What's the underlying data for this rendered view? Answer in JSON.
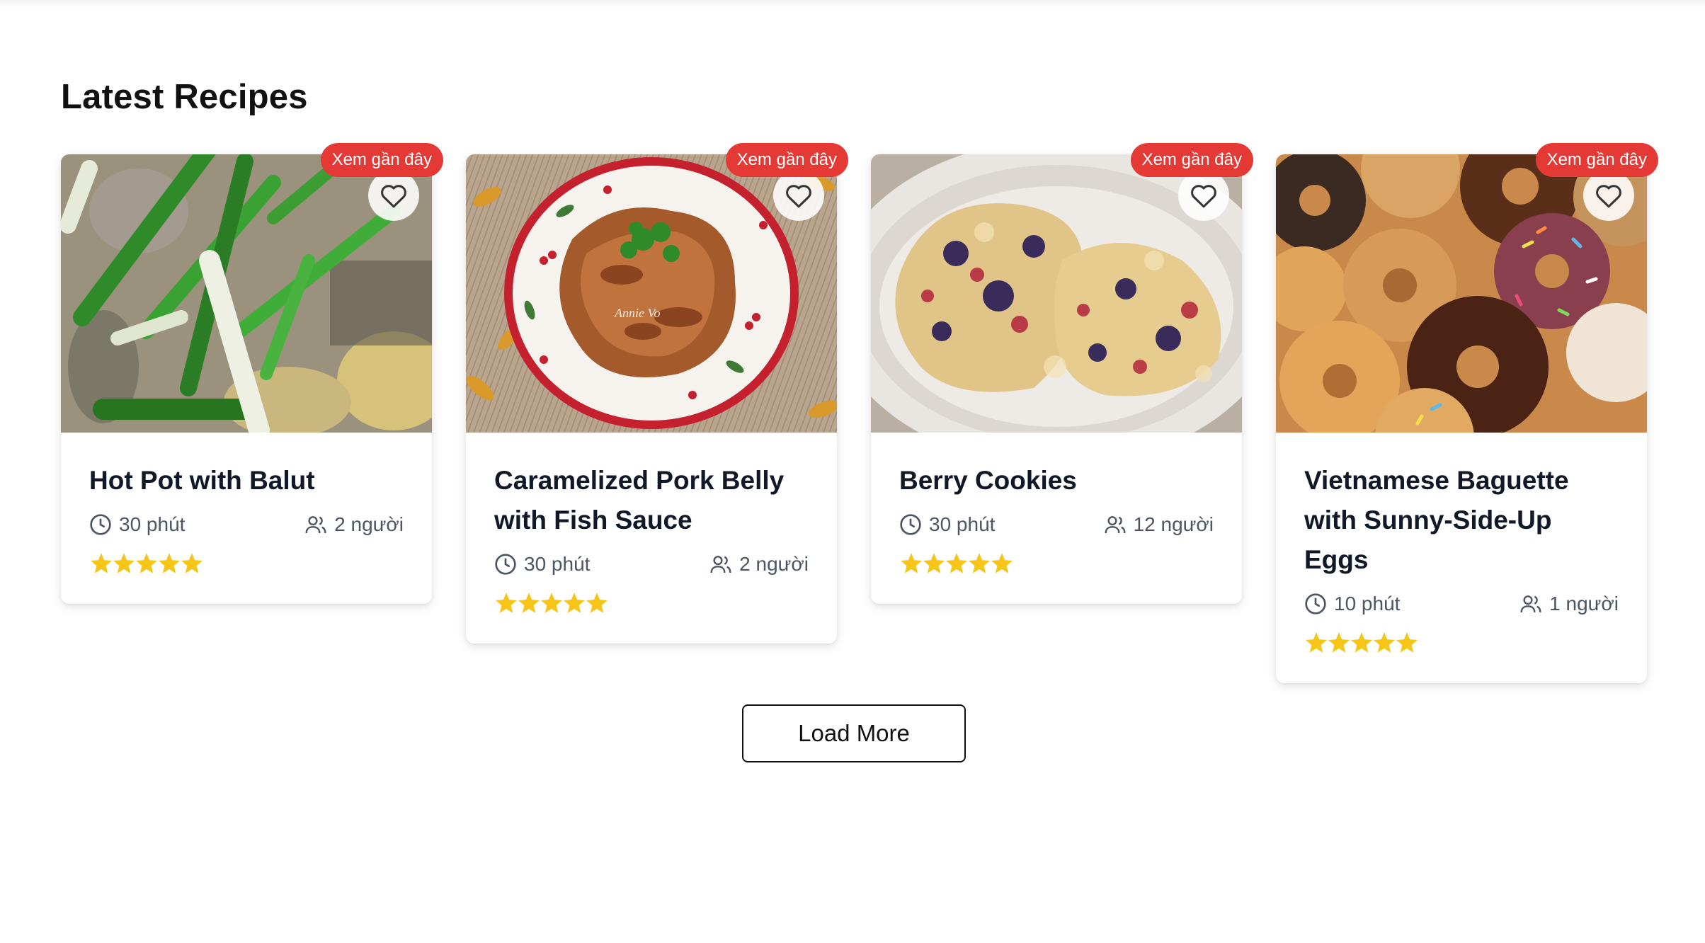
{
  "section": {
    "title": "Latest Recipes"
  },
  "badge_label": "Xem gần đây",
  "rating_max": 5,
  "colors": {
    "badge": "#e53935",
    "star": "#f5c518",
    "meta_text": "#4b5563"
  },
  "recipes": [
    {
      "title": "Hot Pot with Balut",
      "time": "30 phút",
      "servings": "2 người",
      "rating": 5,
      "image": "hot-pot-photo"
    },
    {
      "title": "Caramelized Pork Belly with Fish Sauce",
      "time": "30 phút",
      "servings": "2 người",
      "rating": 5,
      "image": "pork-belly-photo",
      "image_watermark": "Annie Vo"
    },
    {
      "title": "Berry Cookies",
      "time": "30 phút",
      "servings": "12 người",
      "rating": 5,
      "image": "berry-scones-photo"
    },
    {
      "title": "Vietnamese Baguette with Sunny-Side-Up Eggs",
      "time": "10 phút",
      "servings": "1 người",
      "rating": 5,
      "image": "donuts-photo"
    }
  ],
  "load_more_label": "Load More"
}
